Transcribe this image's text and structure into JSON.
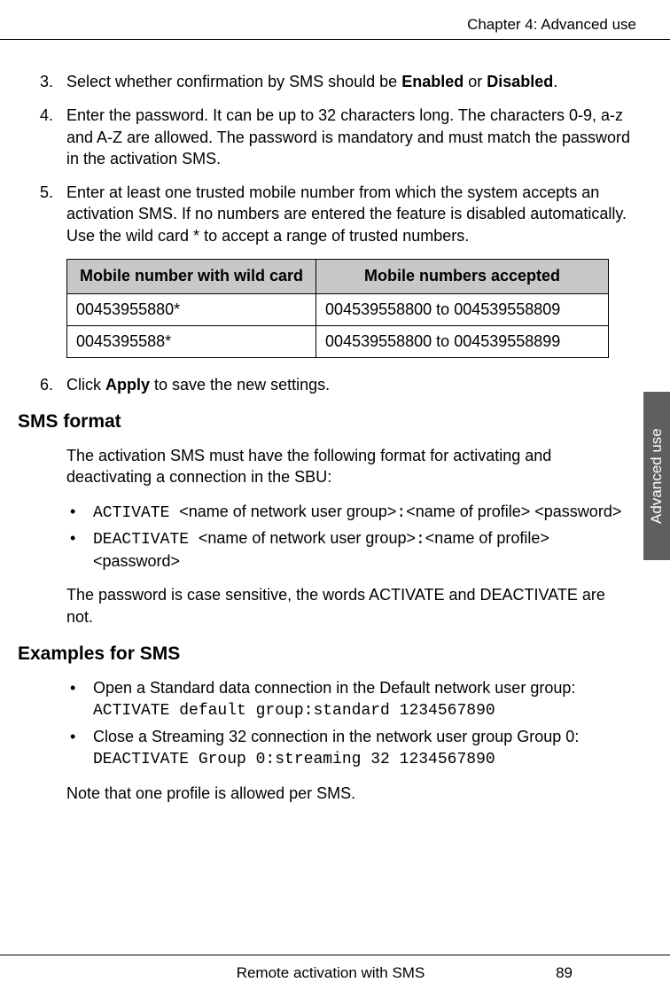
{
  "header": "Chapter 4:  Advanced use",
  "sideTab": "Advanced use",
  "step3": {
    "pre": "Select whether confirmation by SMS should be ",
    "b1": "Enabled",
    "mid": " or ",
    "b2": "Disabled",
    "post": "."
  },
  "step4": "Enter the password. It can be up to 32 characters long. The characters 0-9, a-z and A-Z are allowed. The password is mandatory and must match the password in the activation SMS.",
  "step5": "Enter at least one trusted mobile number from which the system accepts an activation SMS. If no numbers are entered the feature is disabled automatically. Use the wild card * to accept a range of trusted numbers.",
  "table": {
    "h1": "Mobile number with wild card",
    "h2": "Mobile numbers accepted",
    "rows": [
      {
        "c1": "00453955880*",
        "c2": "004539558800 to 004539558809"
      },
      {
        "c1": "0045395588*",
        "c2": "004539558800 to 004539558899"
      }
    ]
  },
  "step6": {
    "pre": "Click ",
    "b": "Apply",
    "post": " to save the new settings."
  },
  "sec1": {
    "title": "SMS format",
    "p1": "The activation SMS must have the following format for activating and deactivating a connection in the SBU:",
    "b1": {
      "code": "ACTIVATE ",
      "t1": "<name of network user group>",
      "colon": ":",
      "t2": "<name of profile> <password>"
    },
    "b2": {
      "code": "DEACTIVATE ",
      "t1": "<name of network user group>",
      "colon": ":",
      "t2": "<name of profile> <password>"
    },
    "p2": "The password is case sensitive, the words ACTIVATE and DEACTIVATE are not."
  },
  "sec2": {
    "title": "Examples for SMS",
    "b1": {
      "t": "Open a Standard data connection in the Default network user group:",
      "code": "ACTIVATE default group:standard 1234567890"
    },
    "b2": {
      "t": "Close a Streaming 32 connection in the network user group Group 0:",
      "code": "DEACTIVATE Group 0:streaming 32 1234567890"
    },
    "p": "Note that one profile is allowed per SMS."
  },
  "footer": {
    "center": "Remote activation with SMS",
    "page": "89"
  }
}
